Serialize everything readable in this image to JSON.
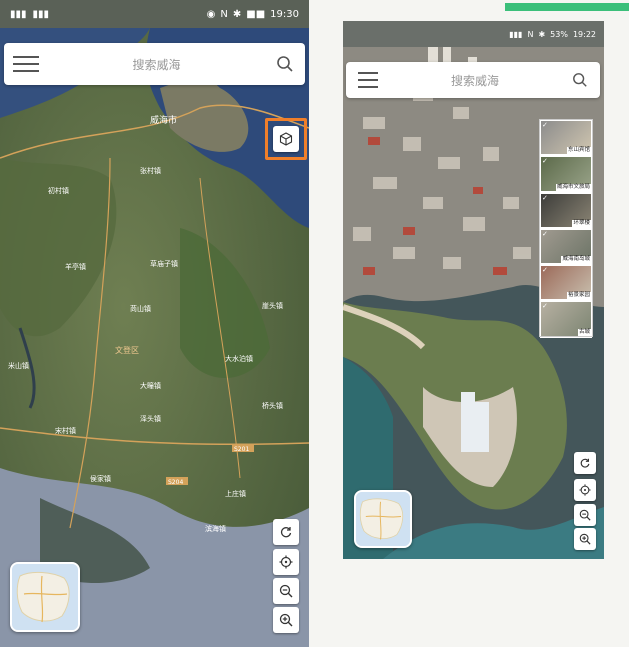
{
  "left_screen": {
    "status_bar": {
      "time": "19:30",
      "battery": "■■"
    },
    "search": {
      "placeholder": "搜索威海"
    },
    "map_labels": [
      "威海市",
      "张村镇",
      "初村镇",
      "草庙子镇",
      "羊亭镇",
      "大水泊镇",
      "崖头镇",
      "米山镇",
      "苘山镇",
      "宋村镇",
      "泽头镇",
      "侯家镇",
      "上庄镇",
      "滨海镇",
      "桥头镇",
      "大疃镇",
      "文登区",
      "S201",
      "S204"
    ],
    "buttons": [
      "3d-view",
      "rotate",
      "locate",
      "zoom-out",
      "zoom-in"
    ]
  },
  "right_screen": {
    "status_bar": {
      "time": "19:22",
      "battery": "53%"
    },
    "search": {
      "placeholder": "搜索威海"
    },
    "layers": [
      {
        "label": "东山宾馆",
        "checked": true
      },
      {
        "label": "威海市文旅局",
        "checked": true
      },
      {
        "label": "环翠楼",
        "checked": true
      },
      {
        "label": "威海南岛城",
        "checked": true
      },
      {
        "label": "裕景家园",
        "checked": true
      },
      {
        "label": "古城",
        "checked": true
      }
    ]
  },
  "colors": {
    "highlight": "#f07f2a",
    "accent_bar": "#3bbf7a"
  }
}
